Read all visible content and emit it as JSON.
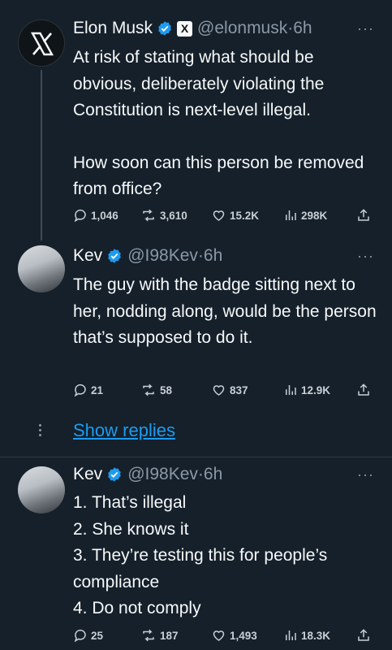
{
  "tweets": [
    {
      "name": "Elon Musk",
      "handle": "@elonmusk",
      "time": "·6h",
      "paragraphs": [
        "At risk of stating what should be obvious, deliberately violating the Constitution is next-level illegal.",
        "How soon can this person be removed from office?"
      ],
      "stats": {
        "replies": "1,046",
        "reposts": "3,610",
        "likes": "15.2K",
        "views": "298K"
      }
    },
    {
      "name": "Kev",
      "handle": "@I98Kev",
      "time": "·6h",
      "paragraphs": [
        "The guy with the badge sitting next to her, nodding along, would be the person that’s supposed to do it."
      ],
      "stats": {
        "replies": "21",
        "reposts": "58",
        "likes": "837",
        "views": "12.9K"
      }
    },
    {
      "name": "Kev",
      "handle": "@I98Kev",
      "time": "·6h",
      "lines": [
        "1. That’s illegal",
        "2. She knows it",
        "3. They’re testing this for people’s compliance",
        "4. Do not comply"
      ],
      "stats": {
        "replies": "25",
        "reposts": "187",
        "likes": "1,493",
        "views": "18.3K"
      }
    }
  ],
  "show_replies_label": "Show replies",
  "more_label": "···",
  "x_badge_label": "X",
  "colors": {
    "background": "#15202b",
    "link": "#1d9bf0",
    "verified": "#1d9bf0",
    "muted": "#8b98a5"
  },
  "icons": [
    "x-logo-icon",
    "verified-badge-icon",
    "reply-icon",
    "repost-icon",
    "like-icon",
    "views-icon",
    "share-icon",
    "more-icon"
  ]
}
